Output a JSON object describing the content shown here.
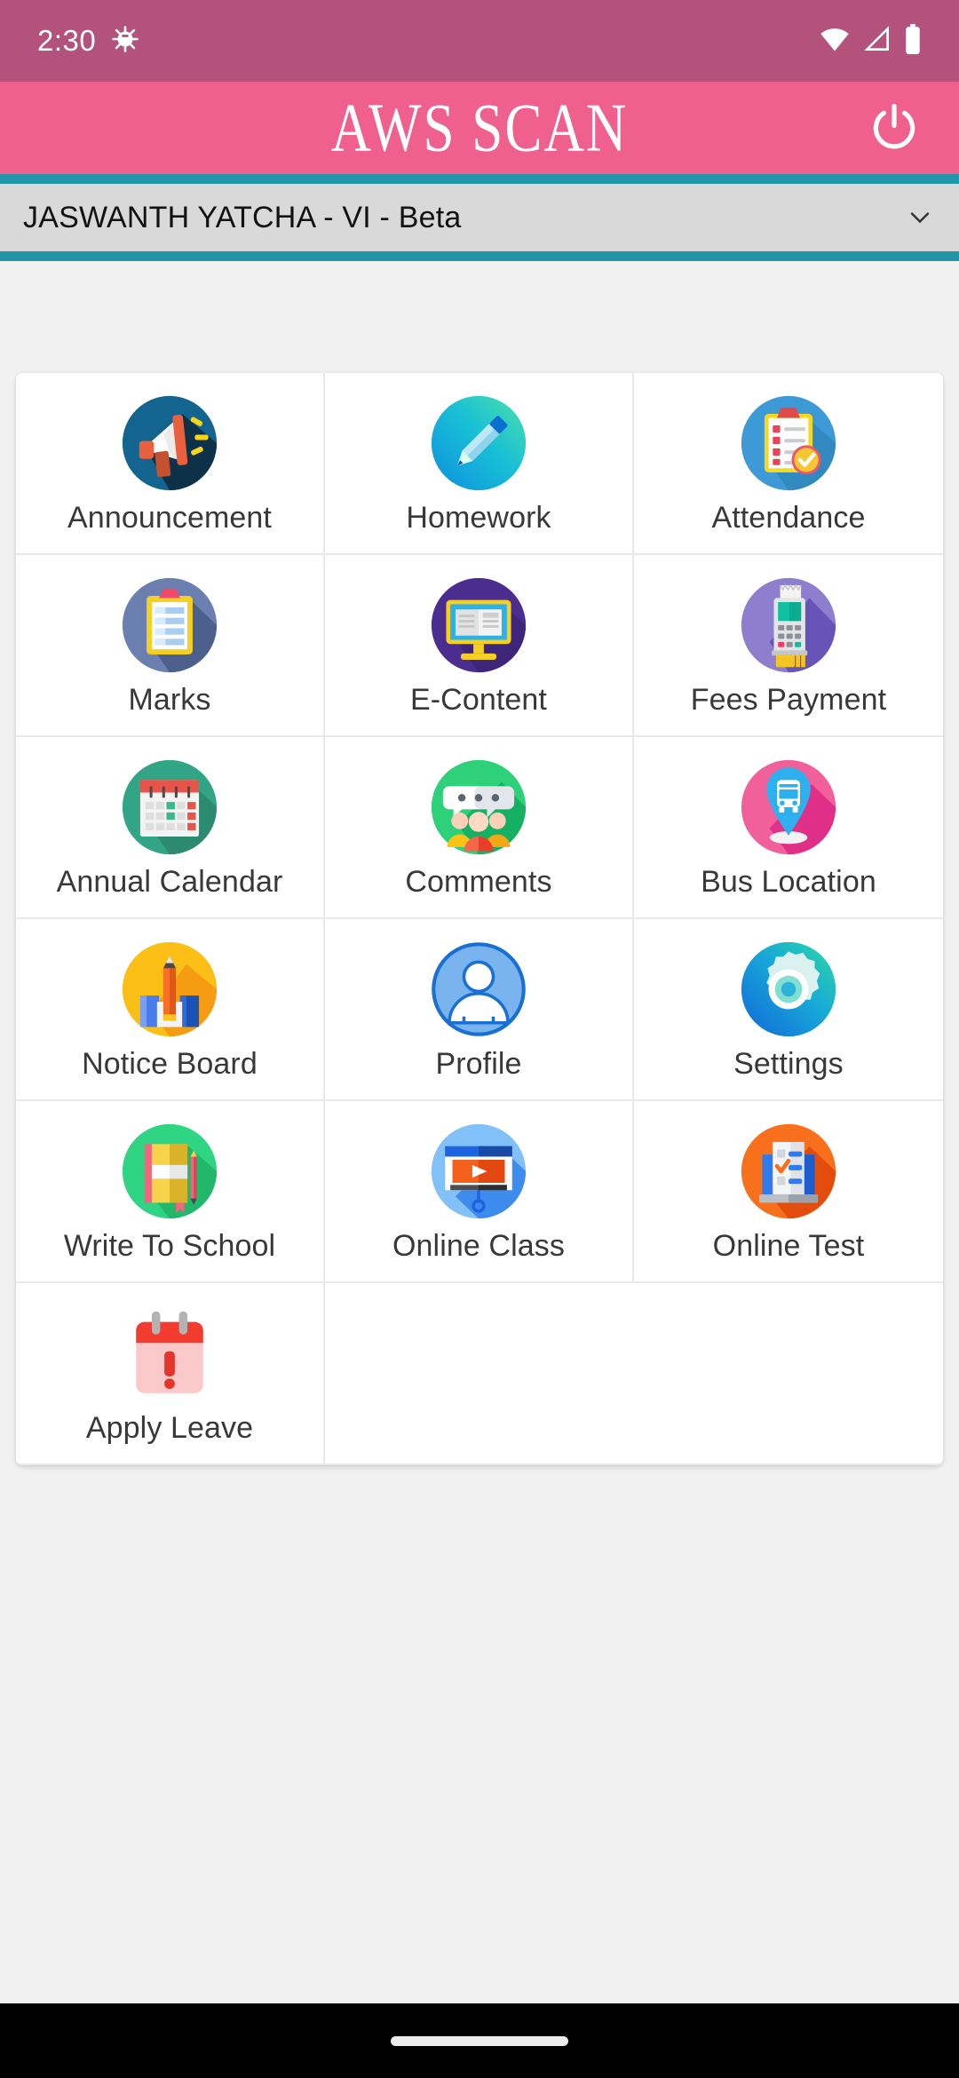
{
  "status_bar": {
    "time": "2:30",
    "icons": [
      "android-debug-icon",
      "wifi-icon",
      "signal-icon",
      "battery-icon"
    ],
    "background_color": "#b3527c"
  },
  "app_bar": {
    "title": "AWS SCAN",
    "power_icon": "power-icon",
    "background_color": "#f0608f",
    "rule_color": "#2196a8"
  },
  "student_selector": {
    "value": "JASWANTH YATCHA - VI - Beta",
    "caret_icon": "chevron-down-icon",
    "background_color": "#d9d9d9"
  },
  "menu": {
    "items": [
      {
        "label": "Announcement",
        "icon": "megaphone-icon"
      },
      {
        "label": "Homework",
        "icon": "pencil-icon"
      },
      {
        "label": "Attendance",
        "icon": "clipboard-check-icon"
      },
      {
        "label": "Marks",
        "icon": "clipboard-lines-icon"
      },
      {
        "label": "E-Content",
        "icon": "monitor-book-icon"
      },
      {
        "label": "Fees Payment",
        "icon": "card-terminal-icon"
      },
      {
        "label": "Annual Calendar",
        "icon": "calendar-icon"
      },
      {
        "label": "Comments",
        "icon": "chat-people-icon"
      },
      {
        "label": "Bus Location",
        "icon": "bus-pin-icon"
      },
      {
        "label": "Notice Board",
        "icon": "books-pencil-icon"
      },
      {
        "label": "Profile",
        "icon": "person-icon"
      },
      {
        "label": "Settings",
        "icon": "gear-icon"
      },
      {
        "label": "Write To School",
        "icon": "notebook-pencil-icon"
      },
      {
        "label": "Online Class",
        "icon": "presentation-video-icon"
      },
      {
        "label": "Online Test",
        "icon": "test-sheet-icon"
      },
      {
        "label": "Apply Leave",
        "icon": "calendar-alert-icon"
      }
    ]
  },
  "nav_bar": {
    "gesture_pill": "home-gesture-pill",
    "background_color": "#000000"
  }
}
